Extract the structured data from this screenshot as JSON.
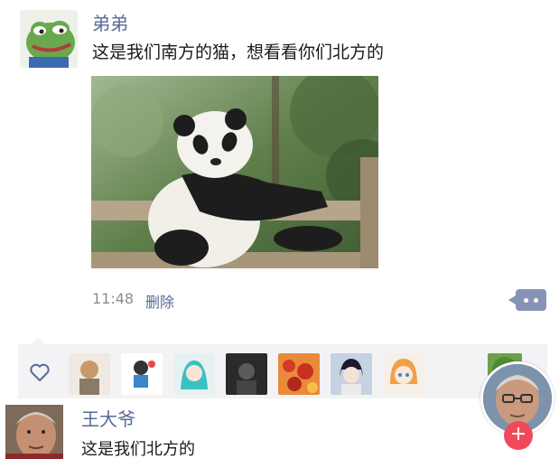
{
  "post": {
    "author": "弟弟",
    "text": "这是我们南方的猫，想看看你们北方的",
    "time": "11:48",
    "delete_label": "删除"
  },
  "comment": {
    "author": "王大爷",
    "text": "这是我们北方的"
  },
  "colors": {
    "link": "#576b95",
    "more_button": "#8793b6",
    "fab": "#f04a5a",
    "likes_bg": "#f3f3f5"
  },
  "icons": {
    "like": "heart-icon",
    "more": "more-dots-icon",
    "fab": "plus-icon"
  }
}
